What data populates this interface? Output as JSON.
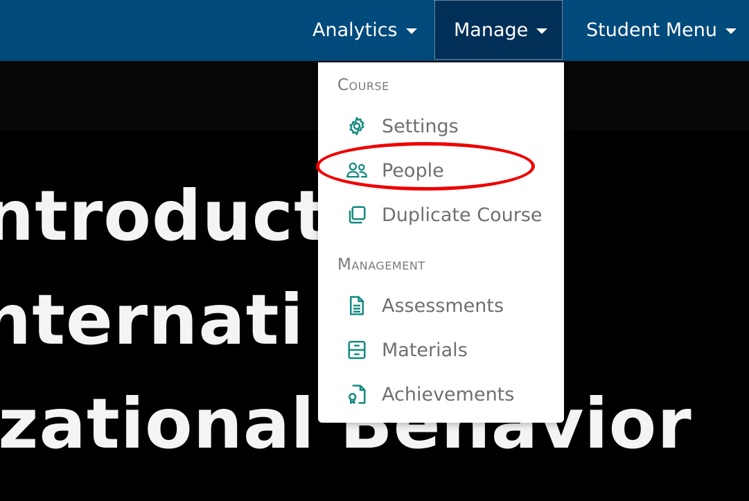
{
  "nav": {
    "analytics_label": "Analytics",
    "manage_label": "Manage",
    "student_menu_label": "Student Menu"
  },
  "hero": {
    "line1": "ntroducti",
    "line2": "nternati",
    "line3": "izational Behavior"
  },
  "dropdown": {
    "course_header": "Course",
    "management_header": "Management",
    "items": {
      "settings": "Settings",
      "people": "People",
      "duplicate": "Duplicate Course",
      "assessments": "Assessments",
      "materials": "Materials",
      "achievements": "Achievements"
    }
  },
  "icons": {
    "settings": "gear-icon",
    "people": "people-icon",
    "duplicate": "copy-icon",
    "assessments": "document-icon",
    "materials": "archive-icon",
    "achievements": "certificate-icon"
  },
  "colors": {
    "topbar": "#014a7c",
    "manage_active": "#012f57",
    "icon_teal": "#138a80",
    "highlight_red": "#ee0000"
  }
}
